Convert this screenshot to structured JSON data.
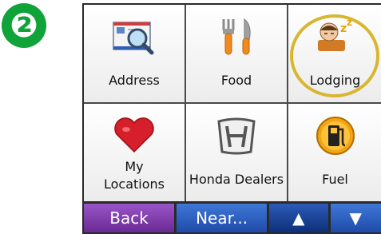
{
  "step": {
    "number": "❷"
  },
  "categories": [
    {
      "label": "Address",
      "icon": "envelope-magnifier-icon"
    },
    {
      "label": "Food",
      "icon": "fork-knife-icon"
    },
    {
      "label": "Lodging",
      "icon": "sleeping-person-icon",
      "highlighted": true
    },
    {
      "label": "My\nLocations",
      "icon": "heart-icon"
    },
    {
      "label": "Honda Dealers",
      "icon": "honda-logo-icon"
    },
    {
      "label": "Fuel",
      "icon": "fuel-pump-icon"
    }
  ],
  "toolbar": {
    "back_label": "Back",
    "near_label": "Near...",
    "up_label": "▲",
    "down_label": "▼"
  },
  "colors": {
    "step_badge": "#0fa33a",
    "highlight_ring": "#d8b630",
    "back_button": "#7d3aa8",
    "near_button": "#2a5cc0"
  }
}
